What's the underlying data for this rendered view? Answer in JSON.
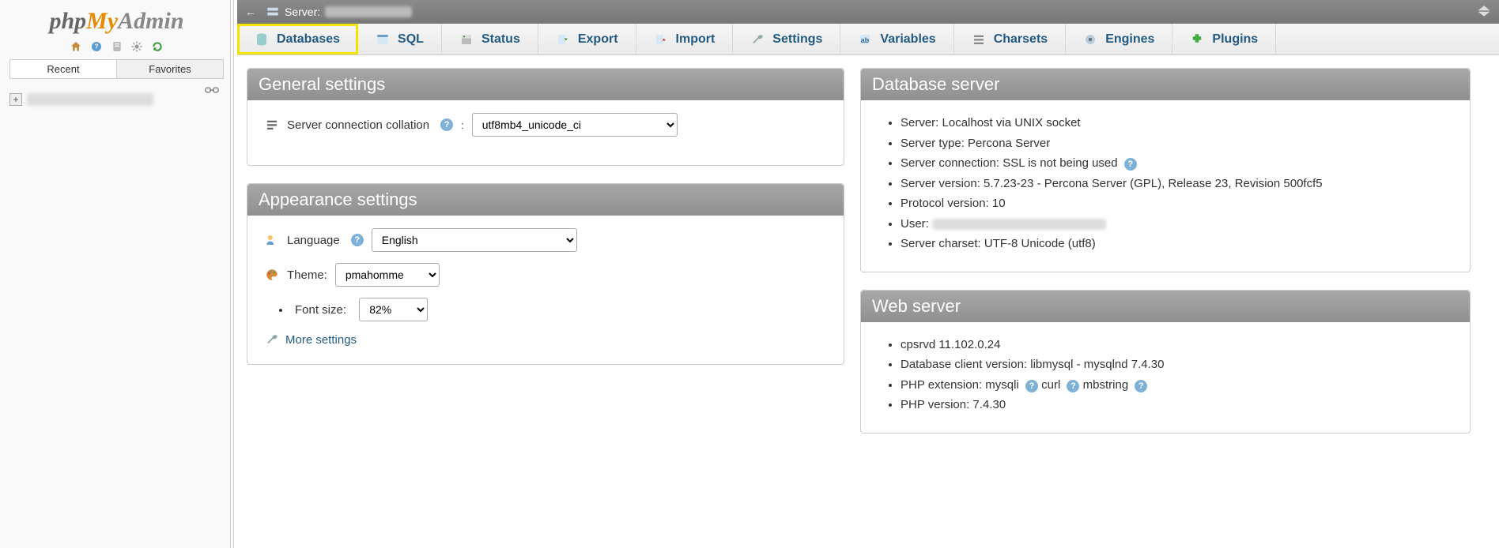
{
  "sidebar": {
    "tabs": {
      "recent": "Recent",
      "favorites": "Favorites"
    }
  },
  "topbar": {
    "server_label": "Server:"
  },
  "tabs": {
    "databases": "Databases",
    "sql": "SQL",
    "status": "Status",
    "export": "Export",
    "import": "Import",
    "settings": "Settings",
    "variables": "Variables",
    "charsets": "Charsets",
    "engines": "Engines",
    "plugins": "Plugins"
  },
  "panels": {
    "general": {
      "title": "General settings",
      "collation_label": "Server connection collation",
      "collation_value": "utf8mb4_unicode_ci"
    },
    "appearance": {
      "title": "Appearance settings",
      "language_label": "Language",
      "language_value": "English",
      "theme_label": "Theme:",
      "theme_value": "pmahomme",
      "fontsize_label": "Font size:",
      "fontsize_value": "82%",
      "more_settings": "More settings"
    },
    "dbserver": {
      "title": "Database server",
      "items": [
        "Server: Localhost via UNIX socket",
        "Server type: Percona Server",
        "Server connection: SSL is not being used",
        "Server version: 5.7.23-23 - Percona Server (GPL), Release 23, Revision 500fcf5",
        "Protocol version: 10",
        "User:",
        "Server charset: UTF-8 Unicode (utf8)"
      ]
    },
    "webserver": {
      "title": "Web server",
      "items": [
        "cpsrvd 11.102.0.24",
        "Database client version: libmysql - mysqlnd 7.4.30",
        "PHP extension: mysqli  curl  mbstring",
        "PHP version: 7.4.30"
      ]
    }
  }
}
